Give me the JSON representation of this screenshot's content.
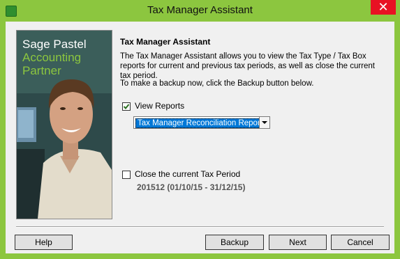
{
  "window": {
    "title": "Tax Manager Assistant",
    "close_glyph": "✕"
  },
  "hero": {
    "brand": "Sage Pastel",
    "line2": "Accounting",
    "line3": "Partner"
  },
  "content": {
    "heading": "Tax Manager Assistant",
    "description": "The Tax Manager Assistant allows you to view the Tax Type / Tax Box reports for current and previous tax periods, as well as close the current tax period.",
    "backup_text": "To make a backup now, click the Backup button below."
  },
  "view_reports": {
    "label": "View Reports",
    "checked": true
  },
  "report_select": {
    "value": "Tax Manager Reconciliation Report"
  },
  "close_period": {
    "label": "Close the current Tax Period",
    "checked": false,
    "period": "201512 (01/10/15 - 31/12/15)"
  },
  "buttons": {
    "help": "Help",
    "backup": "Backup",
    "next": "Next",
    "cancel": "Cancel"
  },
  "colors": {
    "frame": "#8cc63f",
    "close": "#e81123",
    "selection": "#0078d7"
  }
}
